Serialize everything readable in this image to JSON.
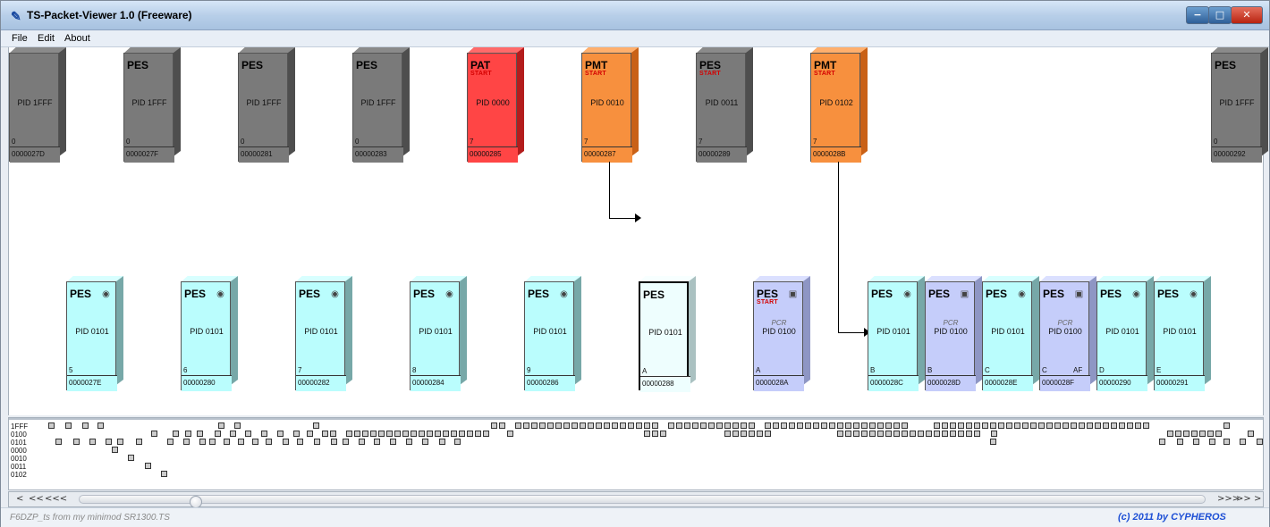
{
  "window": {
    "title": "TS-Packet-Viewer 1.0 (Freeware)",
    "icons": {
      "app": "tools-icon",
      "minimize": "minimize-icon",
      "maximize": "maximize-icon",
      "close": "close-icon"
    }
  },
  "menu": {
    "file": "File",
    "edit": "Edit",
    "about": "About"
  },
  "top_row_packets": [
    {
      "name": "",
      "start": "",
      "pid": "PID 1FFF",
      "counter": "0",
      "offset": "0000027D",
      "color": "gray"
    },
    {
      "name": "PES",
      "start": "",
      "pid": "PID 1FFF",
      "counter": "0",
      "offset": "0000027F",
      "color": "gray"
    },
    {
      "name": "PES",
      "start": "",
      "pid": "PID 1FFF",
      "counter": "0",
      "offset": "00000281",
      "color": "gray"
    },
    {
      "name": "PES",
      "start": "",
      "pid": "PID 1FFF",
      "counter": "0",
      "offset": "00000283",
      "color": "gray"
    },
    {
      "name": "PAT",
      "start": "START",
      "pid": "PID 0000",
      "counter": "7",
      "offset": "00000285",
      "color": "red"
    },
    {
      "name": "PMT",
      "start": "START",
      "pid": "PID 0010",
      "counter": "7",
      "offset": "00000287",
      "color": "orange"
    },
    {
      "name": "PES",
      "start": "START",
      "pid": "PID 0011",
      "counter": "7",
      "offset": "00000289",
      "color": "gray"
    },
    {
      "name": "PMT",
      "start": "START",
      "pid": "PID 0102",
      "counter": "7",
      "offset": "0000028B",
      "color": "orange"
    },
    {
      "name": "PES",
      "start": "",
      "pid": "PID 1FFF",
      "counter": "0",
      "offset": "00000292",
      "color": "gray"
    }
  ],
  "bottom_row_packets": [
    {
      "name": "PES",
      "start": "",
      "pcr": "",
      "pid": "PID 0101",
      "counter": "5",
      "af": "",
      "offset": "0000027E",
      "color": "cyan",
      "icon": "speaker-icon"
    },
    {
      "name": "PES",
      "start": "",
      "pcr": "",
      "pid": "PID 0101",
      "counter": "6",
      "af": "",
      "offset": "00000280",
      "color": "cyan",
      "icon": "speaker-icon"
    },
    {
      "name": "PES",
      "start": "",
      "pcr": "",
      "pid": "PID 0101",
      "counter": "7",
      "af": "",
      "offset": "00000282",
      "color": "cyan",
      "icon": "speaker-icon"
    },
    {
      "name": "PES",
      "start": "",
      "pcr": "",
      "pid": "PID 0101",
      "counter": "8",
      "af": "",
      "offset": "00000284",
      "color": "cyan",
      "icon": "speaker-icon"
    },
    {
      "name": "PES",
      "start": "",
      "pcr": "",
      "pid": "PID 0101",
      "counter": "9",
      "af": "",
      "offset": "00000286",
      "color": "cyan",
      "icon": "speaker-icon"
    },
    {
      "name": "PES",
      "start": "",
      "pcr": "",
      "pid": "PID 0101",
      "counter": "A",
      "af": "",
      "offset": "00000288",
      "color": "selected",
      "icon": ""
    },
    {
      "name": "PES",
      "start": "START",
      "pcr": "PCR",
      "pid": "PID 0100",
      "counter": "A",
      "af": "",
      "offset": "0000028A",
      "color": "lavender",
      "icon": "monitor-icon"
    },
    {
      "name": "PES",
      "start": "",
      "pcr": "",
      "pid": "PID 0101",
      "counter": "B",
      "af": "",
      "offset": "0000028C",
      "color": "cyan",
      "icon": "speaker-icon"
    },
    {
      "name": "PES",
      "start": "",
      "pcr": "PCR",
      "pid": "PID 0100",
      "counter": "B",
      "af": "",
      "offset": "0000028D",
      "color": "lavender",
      "icon": "monitor-icon"
    },
    {
      "name": "PES",
      "start": "",
      "pcr": "",
      "pid": "PID 0101",
      "counter": "C",
      "af": "",
      "offset": "0000028E",
      "color": "cyan",
      "icon": "speaker-icon"
    },
    {
      "name": "PES",
      "start": "",
      "pcr": "PCR",
      "pid": "PID 0100",
      "counter": "C",
      "af": "AF",
      "offset": "0000028F",
      "color": "lavender",
      "icon": "monitor-icon"
    },
    {
      "name": "PES",
      "start": "",
      "pcr": "",
      "pid": "PID 0101",
      "counter": "D",
      "af": "",
      "offset": "00000290",
      "color": "cyan",
      "icon": "speaker-icon"
    },
    {
      "name": "PES",
      "start": "",
      "pcr": "",
      "pid": "PID 0101",
      "counter": "E",
      "af": "",
      "offset": "00000291",
      "color": "cyan",
      "icon": "speaker-icon"
    }
  ],
  "timeline": {
    "row_labels": [
      "1FFF",
      "0100",
      "0101",
      "0000",
      "0010",
      "0011",
      "0102"
    ]
  },
  "scrollbar": {
    "left_1": "<",
    "left_2": "<<",
    "left_3": "<<<",
    "right_1": ">>>",
    "right_2": ">>",
    "right_3": ">"
  },
  "status": {
    "left": "F6DZP_ts from my minimod SR1300.TS",
    "right": "(c) 2011 by CYPHEROS"
  }
}
